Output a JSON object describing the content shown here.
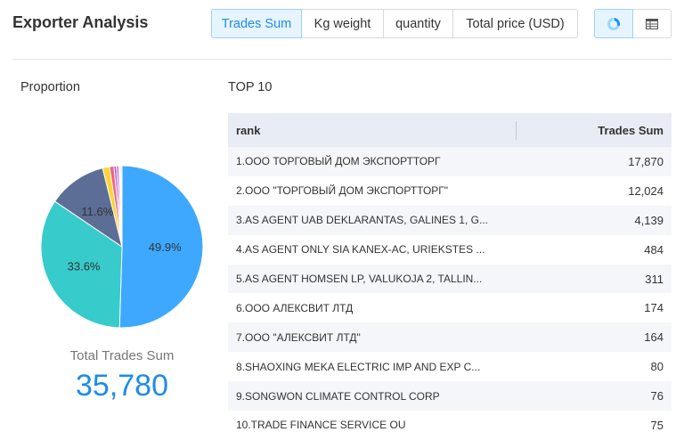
{
  "header": {
    "title": "Exporter Analysis",
    "tabs": [
      {
        "label": "Trades Sum",
        "active": true
      },
      {
        "label": "Kg weight",
        "active": false
      },
      {
        "label": "quantity",
        "active": false
      },
      {
        "label": "Total price (USD)",
        "active": false
      }
    ],
    "view_toggle": [
      {
        "icon": "pie-chart-icon",
        "active": true
      },
      {
        "icon": "table-icon",
        "active": false
      }
    ]
  },
  "chart_data": {
    "type": "pie",
    "title": "Proportion",
    "slices": [
      {
        "value": 17870,
        "label": "49.9%",
        "color": "#3ea8ff"
      },
      {
        "value": 12024,
        "label": "33.6%",
        "color": "#37cbcb"
      },
      {
        "value": 4139,
        "label": "11.6%",
        "color": "#5c6e95"
      },
      {
        "value": 484,
        "color": "#fbd437"
      },
      {
        "value": 311,
        "color": "#f2637b"
      },
      {
        "value": 174,
        "color": "#975fe5"
      },
      {
        "value": 164,
        "color": "#e85fb0"
      },
      {
        "value": 80,
        "color": "#6b8cf0"
      },
      {
        "value": 76,
        "color": "#4ecb73"
      },
      {
        "value": 75,
        "color": "#f0884f"
      }
    ]
  },
  "summary": {
    "label": "Total Trades Sum",
    "value": "35,780"
  },
  "top10": {
    "title": "TOP 10",
    "rank_header": "rank",
    "value_header": "Trades Sum",
    "rows": [
      {
        "rank": "1.OOO ТОРГОВЫЙ ДОМ ЭКСПОРТТОРГ",
        "value": "17,870"
      },
      {
        "rank": "2.OOO \"ТОРГОВЫЙ ДОМ ЭКСПОРТТОРГ\"",
        "value": "12,024"
      },
      {
        "rank": "3.AS AGENT UAB DEKLARANTAS, GALINES 1, G...",
        "value": "4,139"
      },
      {
        "rank": "4.AS AGENT ONLY SIA KANEX-AC, URIEKSTES ...",
        "value": "484"
      },
      {
        "rank": "5.AS AGENT HOMSEN LP, VALUKOJA 2, TALLIN...",
        "value": "311"
      },
      {
        "rank": "6.OOO АЛЕКСВИТ ЛТД",
        "value": "174"
      },
      {
        "rank": "7.OOO \"АЛЕКСВИТ ЛТД\"",
        "value": "164"
      },
      {
        "rank": "8.SHAOXING MEKA ELECTRIC IMP AND EXP C...",
        "value": "80"
      },
      {
        "rank": "9.SONGWON CLIMATE CONTROL CORP",
        "value": "76"
      },
      {
        "rank": "10.TRADE FINANCE SERVICE OU",
        "value": "75"
      }
    ]
  },
  "colors": {
    "accent": "#1e8ce8",
    "table_header_bg": "#e8ecf5",
    "row_stripe_bg": "#f5f6fa"
  }
}
